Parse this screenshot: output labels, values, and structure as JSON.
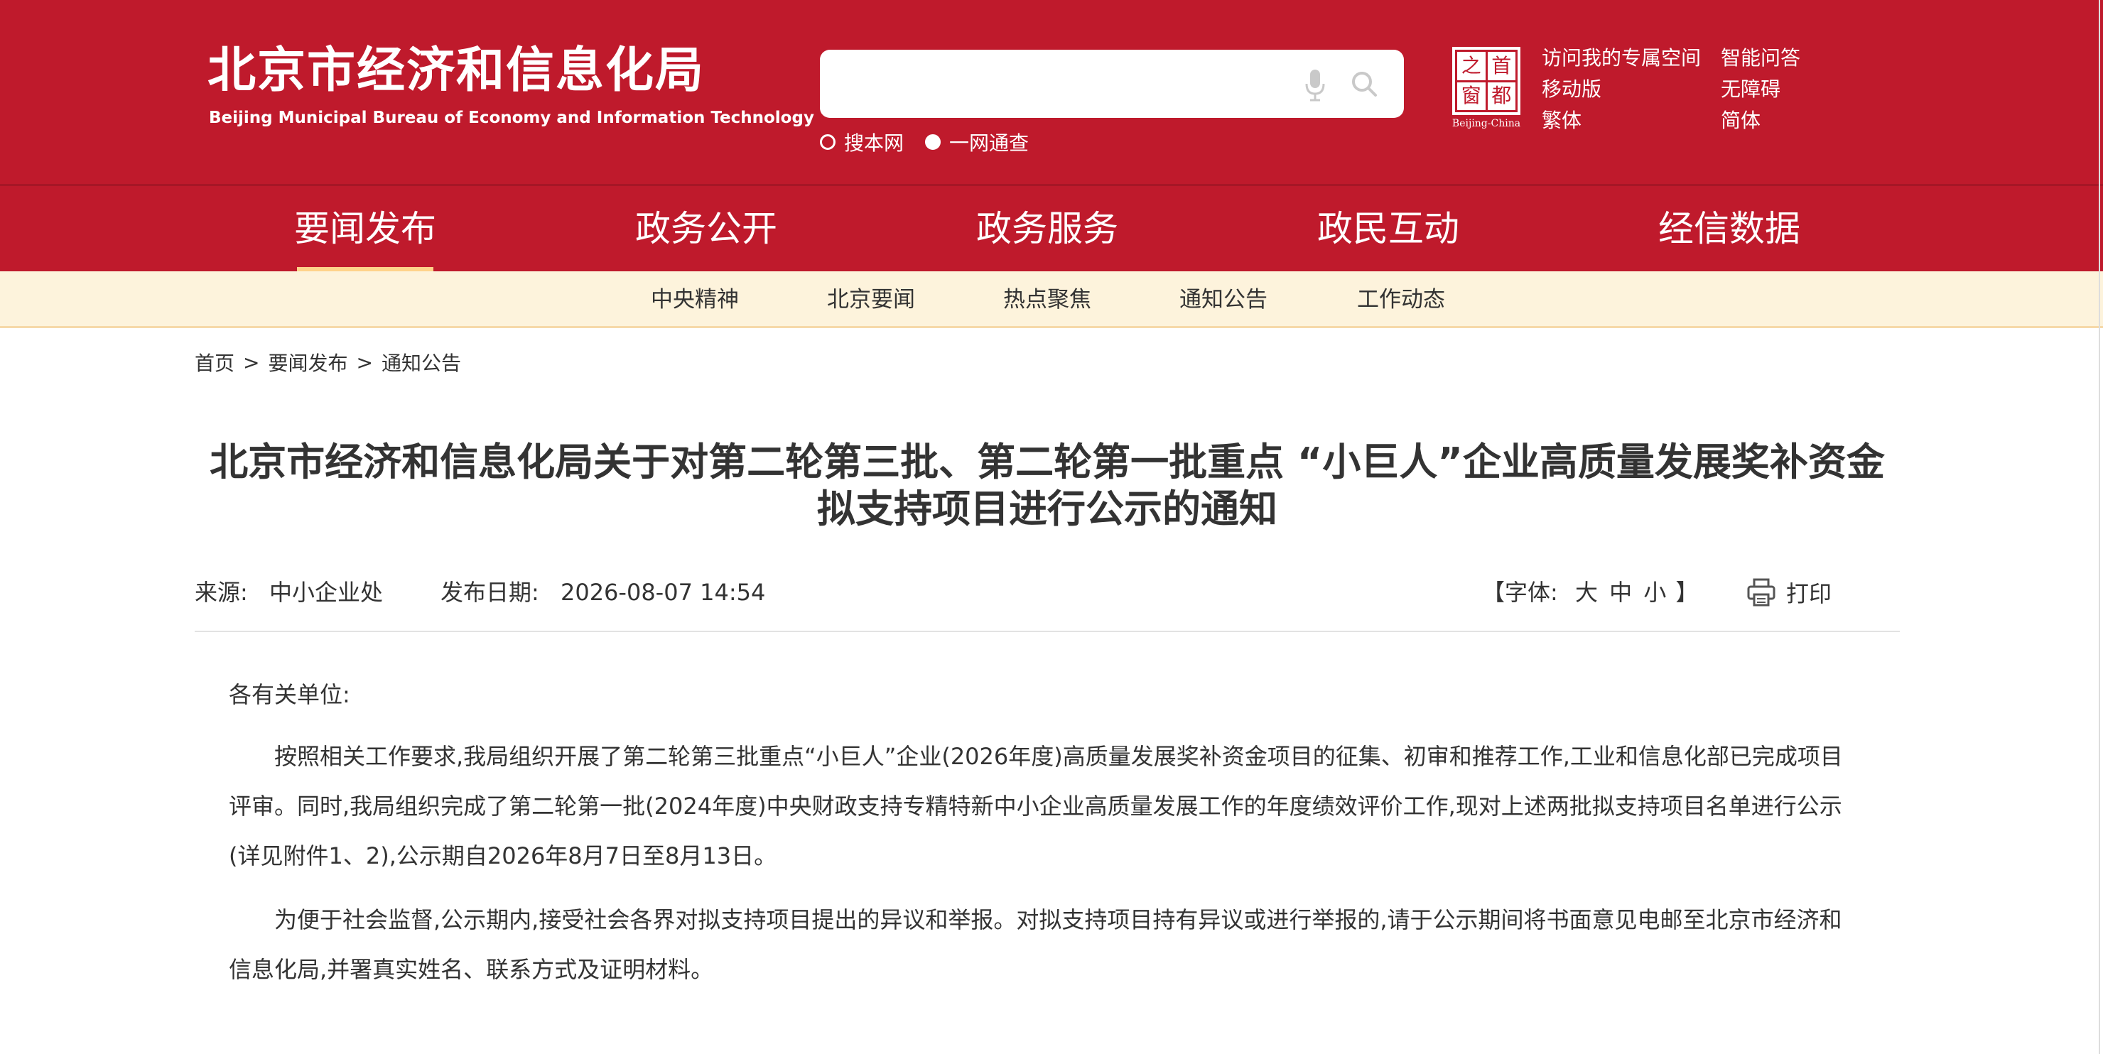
{
  "header": {
    "logo_cn": "北京市经济和信息化局",
    "logo_en": "Beijing Municipal Bureau of Economy and Information Technology",
    "search": {
      "placeholder": ""
    },
    "search_scope": [
      {
        "label": "搜本网",
        "selected": false
      },
      {
        "label": "一网通查",
        "selected": true
      }
    ],
    "seal": {
      "chars": [
        "之",
        "首",
        "窗",
        "都"
      ],
      "caption": "Beijing-China"
    },
    "util_links": [
      "访问我的专属空间",
      "智能问答",
      "移动版",
      "无障碍",
      "繁体",
      "简体"
    ]
  },
  "main_nav": {
    "items": [
      "要闻发布",
      "政务公开",
      "政务服务",
      "政民互动",
      "经信数据"
    ],
    "active": "要闻发布"
  },
  "sub_nav": {
    "items": [
      "中央精神",
      "北京要闻",
      "热点聚焦",
      "通知公告",
      "工作动态"
    ]
  },
  "breadcrumb": [
    "首页",
    "要闻发布",
    "通知公告"
  ],
  "breadcrumb_sep": ">",
  "article": {
    "title": "北京市经济和信息化局关于对第二轮第三批、第二轮第一批重点 “小巨人”企业高质量发展奖补资金拟支持项目进行公示的通知",
    "source_label": "来源:",
    "source": "中小企业处",
    "date_label": "发布日期:",
    "date": "2026-08-07 14:54",
    "font_open": "【字体:",
    "font_sizes": [
      "大",
      "中",
      "小"
    ],
    "font_close": "】",
    "print_label": "打印",
    "salutation": "各有关单位:",
    "paragraphs": [
      "按照相关工作要求,我局组织开展了第二轮第三批重点“小巨人”企业(2026年度)高质量发展奖补资金项目的征集、初审和推荐工作,工业和信息化部已完成项目评审。同时,我局组织完成了第二轮第一批(2024年度)中央财政支持专精特新中小企业高质量发展工作的年度绩效评价工作,现对上述两批拟支持项目名单进行公示(详见附件1、2),公示期自2026年8月7日至8月13日。",
      "为便于社会监督,公示期内,接受社会各界对拟支持项目提出的异议和举报。对拟支持项目持有异议或进行举报的,请于公示期间将书面意见电邮至北京市经济和信息化局,并署真实姓名、联系方式及证明材料。"
    ]
  },
  "colors": {
    "brand_red": "#bf1a2c",
    "sub_nav_bg": "#fdf3dc",
    "active_underline": "#ffd28a",
    "text": "#333333"
  },
  "icons": [
    "microphone-icon",
    "search-icon",
    "print-icon"
  ]
}
